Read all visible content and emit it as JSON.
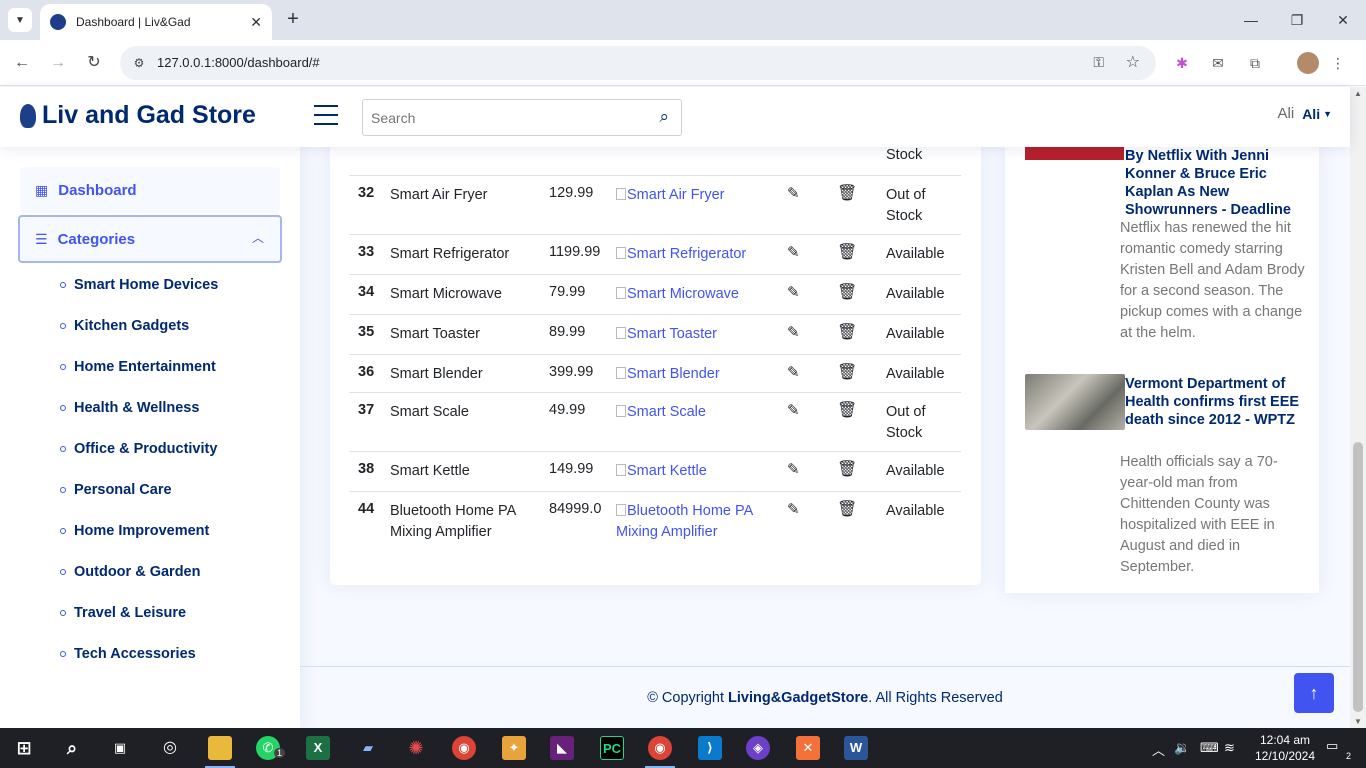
{
  "browser": {
    "tab_title": "Dashboard | Liv&Gad",
    "url": "127.0.0.1:8000/dashboard/#"
  },
  "header": {
    "logo_text": "Liv and Gad Store",
    "search_placeholder": "Search",
    "avatar_alt": "Ali",
    "profile_name": "Ali"
  },
  "sidebar": {
    "dashboard_label": "Dashboard",
    "categories_label": "Categories",
    "categories": [
      "Smart Home Devices",
      "Kitchen Gadgets",
      "Home Entertainment",
      "Health & Wellness",
      "Office & Productivity",
      "Personal Care",
      "Home Improvement",
      "Outdoor & Garden",
      "Travel & Leisure",
      "Tech Accessories"
    ]
  },
  "table": {
    "partial_status": "Stock",
    "rows": [
      {
        "id": "32",
        "name": "Smart Air Fryer",
        "price": "129.99",
        "image_alt": "Smart Air Fryer",
        "status": "Out of Stock"
      },
      {
        "id": "33",
        "name": "Smart Refrigerator",
        "price": "1199.99",
        "image_alt": "Smart Refrigerator",
        "status": "Available"
      },
      {
        "id": "34",
        "name": "Smart Microwave",
        "price": "79.99",
        "image_alt": "Smart Microwave",
        "status": "Available"
      },
      {
        "id": "35",
        "name": "Smart Toaster",
        "price": "89.99",
        "image_alt": "Smart Toaster",
        "status": "Available"
      },
      {
        "id": "36",
        "name": "Smart Blender",
        "price": "399.99",
        "image_alt": "Smart Blender",
        "status": "Available"
      },
      {
        "id": "37",
        "name": "Smart Scale",
        "price": "49.99",
        "image_alt": "Smart Scale",
        "status": "Out of Stock"
      },
      {
        "id": "38",
        "name": "Smart Kettle",
        "price": "149.99",
        "image_alt": "Smart Kettle",
        "status": "Available"
      },
      {
        "id": "44",
        "name": "Bluetooth Home PA Mixing Amplifier",
        "price": "84999.0",
        "image_alt": "Bluetooth Home PA Mixing Amplifier",
        "status": "Available"
      }
    ]
  },
  "news": [
    {
      "title": "By Netflix With Jenni Konner & Bruce Eric Kaplan As New Showrunners - Deadline",
      "description": "Netflix has renewed the hit romantic comedy starring Kristen Bell and Adam Brody for a second season. The pickup comes with a change at the helm."
    },
    {
      "title": "Vermont Department of Health confirms first EEE death since 2012 - WPTZ",
      "description": "Health officials say a 70-year-old man from Chittenden County was hospitalized with EEE in August and died in September."
    }
  ],
  "footer": {
    "prefix": "© Copyright ",
    "brand": "Living&GadgetStore",
    "suffix": ". All Rights Reserved"
  },
  "taskbar": {
    "time": "12:04 am",
    "date": "12/10/2024",
    "whatsapp_badge": "1",
    "notification_count": "2"
  },
  "colors": {
    "accent": "#4154f1",
    "brand_navy": "#012970",
    "back_to_top": "#4154f1"
  }
}
